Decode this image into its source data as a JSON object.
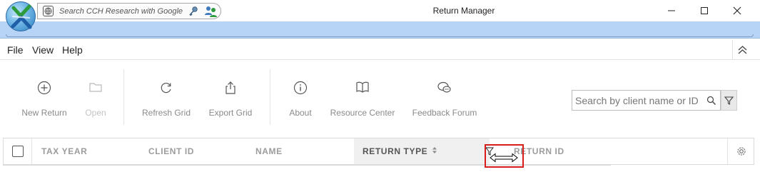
{
  "titlebar": {
    "title": "Return Manager",
    "search_placeholder": "Search CCH Research with Google",
    "icons": [
      "app-logo",
      "globe-icon",
      "key-icon",
      "people-icon"
    ],
    "window_buttons": [
      "minimize-icon",
      "maximize-icon",
      "close-icon"
    ]
  },
  "menu": {
    "items": [
      "File",
      "View",
      "Help"
    ],
    "collapse_icon": "chevron-up-double-icon"
  },
  "toolbar": {
    "buttons": [
      {
        "label": "New Return",
        "icon": "plus-circle-icon",
        "enabled": true
      },
      {
        "label": "Open",
        "icon": "folder-icon",
        "enabled": false
      },
      {
        "label": "Refresh Grid",
        "icon": "refresh-icon",
        "enabled": true
      },
      {
        "label": "Export Grid",
        "icon": "export-icon",
        "enabled": true
      },
      {
        "label": "About",
        "icon": "info-icon",
        "enabled": true
      },
      {
        "label": "Resource Center",
        "icon": "book-icon",
        "enabled": true
      },
      {
        "label": "Feedback Forum",
        "icon": "chat-icon",
        "enabled": true
      }
    ],
    "search_placeholder": "Search by client name or ID"
  },
  "grid": {
    "columns": [
      "TAX YEAR",
      "CLIENT ID",
      "NAME",
      "RETURN TYPE",
      "RETURN ID"
    ],
    "active_column": "RETURN TYPE",
    "active_sort_icon": "sort-updown-icon",
    "settings_icon": "gear-icon"
  },
  "colors": {
    "accent_band": "#b7d4f6",
    "highlight": "#d81c1c"
  }
}
